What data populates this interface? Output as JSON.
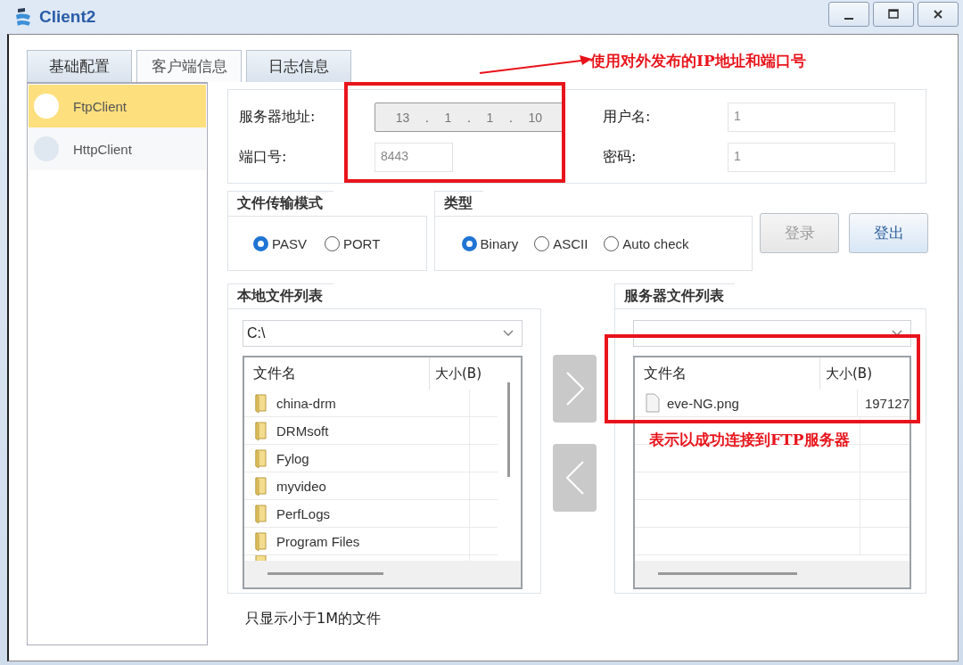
{
  "window": {
    "title": "Client2"
  },
  "tabs": [
    {
      "label": "基础配置",
      "selected": false
    },
    {
      "label": "客户端信息",
      "selected": true
    },
    {
      "label": "日志信息",
      "selected": false
    }
  ],
  "sidebar": {
    "items": [
      {
        "label": "FtpClient",
        "selected": true
      },
      {
        "label": "HttpClient",
        "selected": false
      }
    ]
  },
  "server": {
    "address_label": "服务器地址:",
    "address_octets": [
      "13",
      "1",
      "1",
      "10"
    ],
    "address_separator": ".",
    "port_label": "端口号:",
    "port": "8443",
    "username_label": "用户名:",
    "username": "1",
    "password_label": "密码:",
    "password": "1"
  },
  "transfer_mode": {
    "title": "文件传输模式",
    "options": [
      {
        "label": "PASV",
        "selected": true
      },
      {
        "label": "PORT",
        "selected": false
      }
    ]
  },
  "type": {
    "title": "类型",
    "options": [
      {
        "label": "Binary",
        "selected": true
      },
      {
        "label": "ASCII",
        "selected": false
      },
      {
        "label": "Auto check",
        "selected": false
      }
    ]
  },
  "buttons": [
    {
      "label": "登录",
      "disabled": true
    },
    {
      "label": "登出",
      "disabled": false
    }
  ],
  "local_files": {
    "title": "本地文件列表",
    "path": "C:\\",
    "columns": [
      "文件名",
      "大小(B)"
    ],
    "rows": [
      {
        "name": "china-drm",
        "kind": "folder"
      },
      {
        "name": "DRMsoft",
        "kind": "folder"
      },
      {
        "name": "Fylog",
        "kind": "folder"
      },
      {
        "name": "myvideo",
        "kind": "folder"
      },
      {
        "name": "PerfLogs",
        "kind": "folder"
      },
      {
        "name": "Program Files",
        "kind": "folder"
      }
    ]
  },
  "server_files": {
    "title": "服务器文件列表",
    "columns": [
      "文件名",
      "大小(B)"
    ],
    "rows": [
      {
        "name": "eve-NG.png",
        "size": "197127",
        "kind": "file"
      }
    ]
  },
  "footer_note": "只显示小于1M的文件",
  "annotations": [
    {
      "text": "使用对外发布的IP地址和端口号"
    },
    {
      "text": "表示以成功连接到FTP服务器"
    }
  ]
}
